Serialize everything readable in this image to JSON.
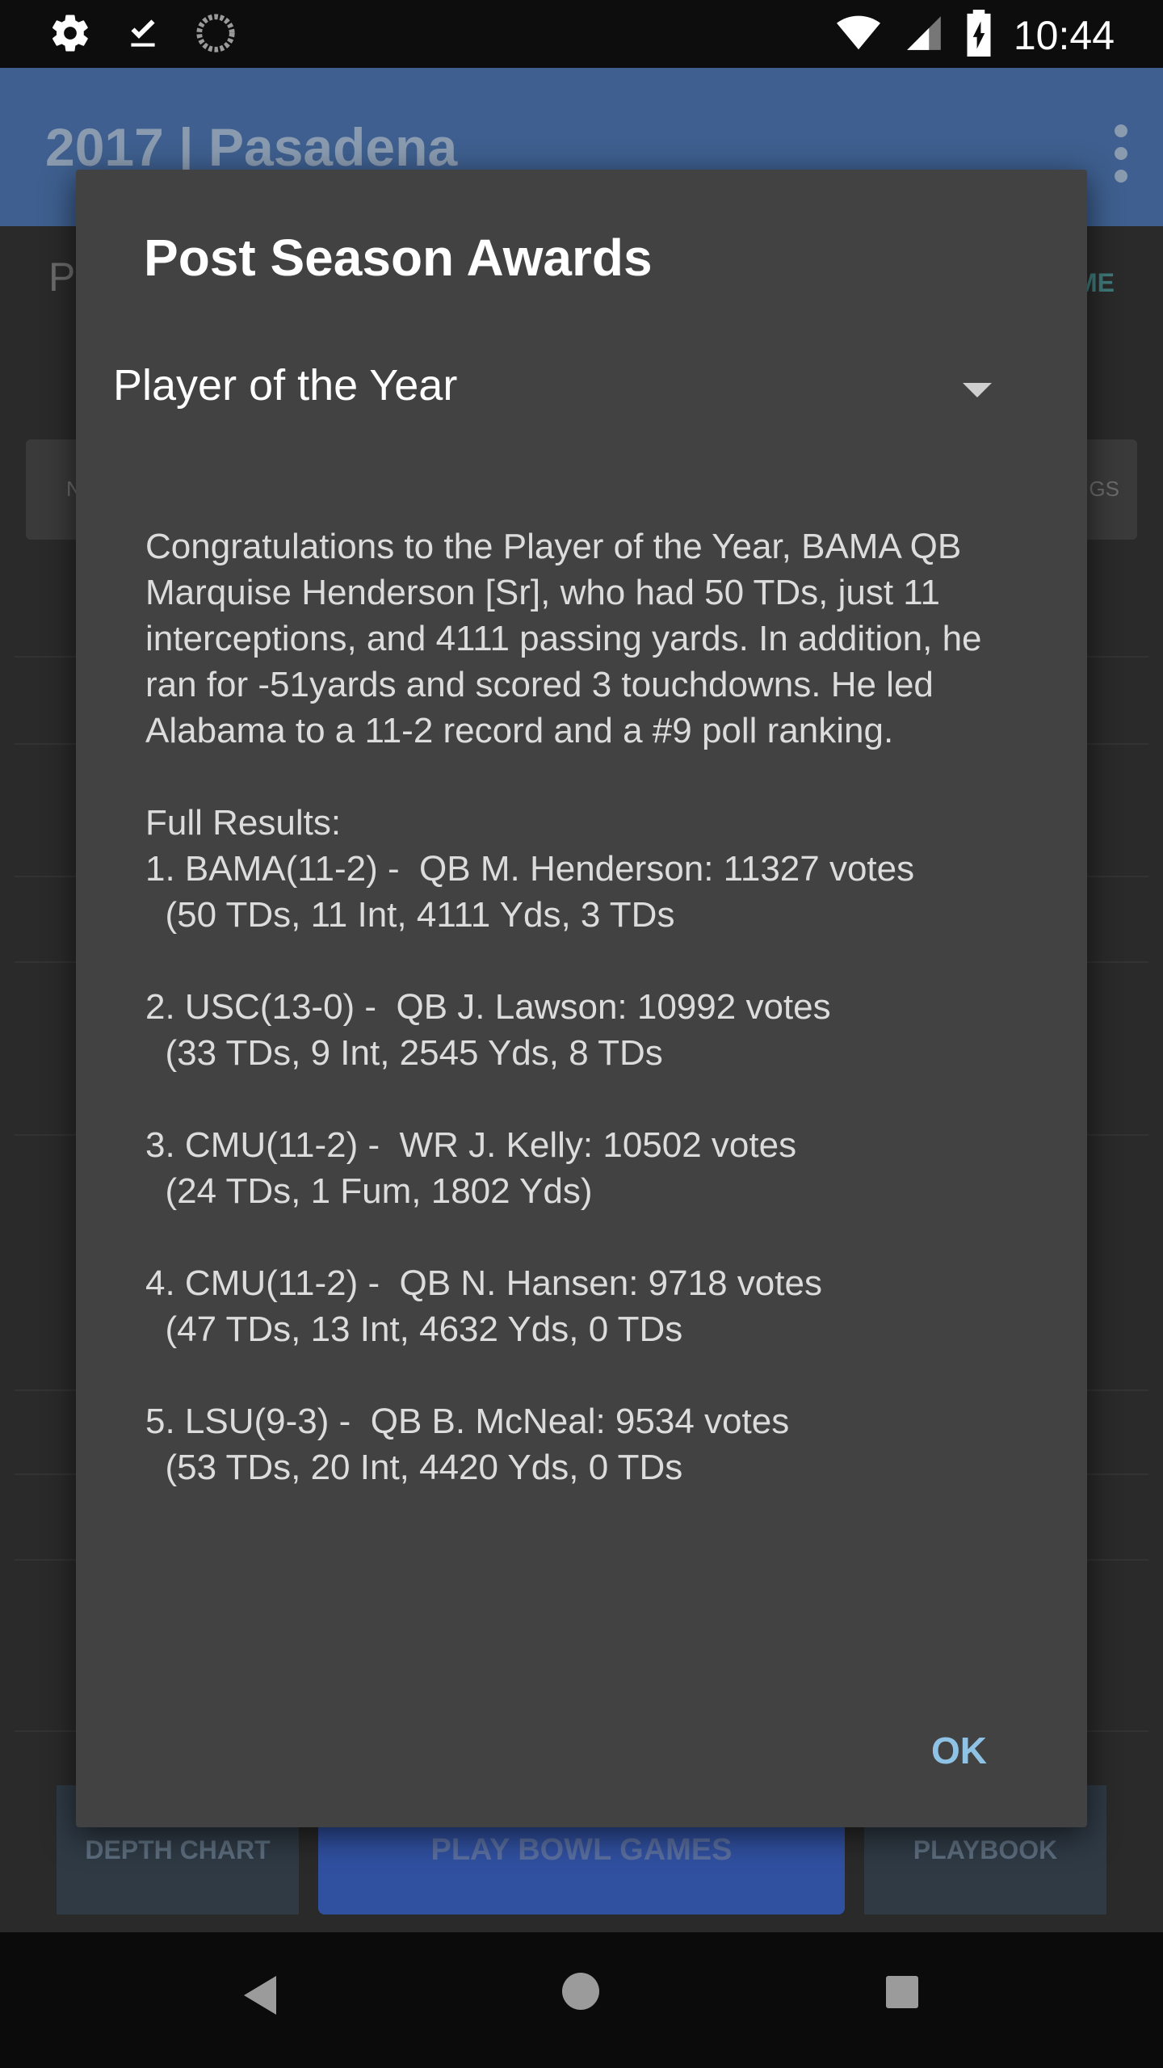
{
  "status_bar": {
    "time": "10:44",
    "left_icons": [
      "settings-icon",
      "download-done-icon",
      "loading-icon"
    ],
    "right_icons": [
      "wifi-icon",
      "cell-signal-icon",
      "battery-charging-icon"
    ]
  },
  "app": {
    "title": "2017 | Pasadena",
    "subtab_left": "P",
    "subtab_right": "ME",
    "pill_left": "N",
    "pill_right": "GS",
    "buttons": {
      "depth_chart": "DEPTH CHART",
      "play_bowl_games": "PLAY BOWL GAMES",
      "playbook": "PLAYBOOK"
    }
  },
  "dialog": {
    "title": "Post Season Awards",
    "selected_award": "Player of the Year",
    "message": "Congratulations to the Player of the Year, BAMA QB Marquise Henderson [Sr], who had 50 TDs, just 11 interceptions, and 4111 passing yards. In addition, he ran for -51yards and scored 3 touchdowns. He led Alabama to a 11-2 record and a #9 poll ranking.\n\nFull Results:\n1. BAMA(11-2) -  QB M. Henderson: 11327 votes\n  (50 TDs, 11 Int, 4111 Yds, 3 TDs\n\n2. USC(13-0) -  QB J. Lawson: 10992 votes\n  (33 TDs, 9 Int, 2545 Yds, 8 TDs\n\n3. CMU(11-2) -  WR J. Kelly: 10502 votes\n  (24 TDs, 1 Fum, 1802 Yds)\n\n4. CMU(11-2) -  QB N. Hansen: 9718 votes\n  (47 TDs, 13 Int, 4632 Yds, 0 TDs\n\n5. LSU(9-3) -  QB B. McNeal: 9534 votes\n  (53 TDs, 20 Int, 4420 Yds, 0 TDs",
    "ok_label": "OK"
  }
}
